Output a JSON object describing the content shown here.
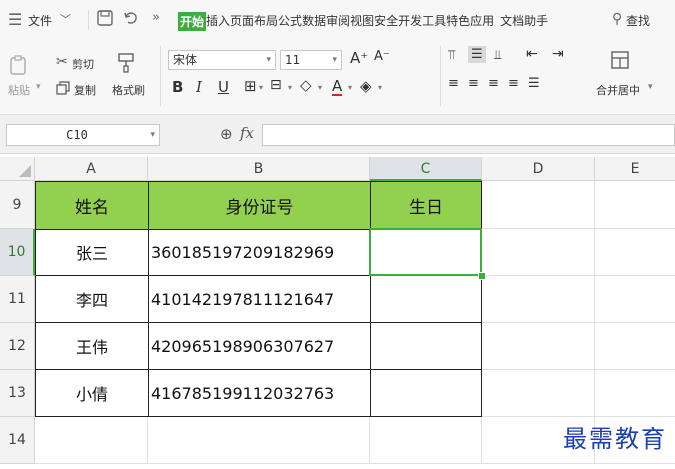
{
  "menubar": {
    "file_label": "文件",
    "tabs": [
      {
        "label": "开始"
      },
      {
        "label": "插入"
      },
      {
        "label": "页面布局"
      },
      {
        "label": "公式"
      },
      {
        "label": "数据"
      },
      {
        "label": "审阅"
      },
      {
        "label": "视图"
      },
      {
        "label": "安全"
      },
      {
        "label": "开发工具"
      },
      {
        "label": "特色应用"
      },
      {
        "label": "文档助手"
      }
    ],
    "search_label": "查找"
  },
  "ribbon": {
    "paste_label": "粘贴",
    "cut_label": "剪切",
    "copy_label": "复制",
    "format_painter_label": "格式刷",
    "font_name": "宋体",
    "font_size": "11",
    "merge_label": "合并居中"
  },
  "formula_bar": {
    "name_box": "C10",
    "fx_label": "fx",
    "formula_value": ""
  },
  "sheet": {
    "columns": [
      "A",
      "B",
      "C",
      "D",
      "E"
    ],
    "selected_column": "C",
    "rows": [
      {
        "num": "9",
        "a": "姓名",
        "b": "身份证号",
        "c": "生日"
      },
      {
        "num": "10",
        "a": "张三",
        "b": "360185197209182969",
        "c": ""
      },
      {
        "num": "11",
        "a": "李四",
        "b": "410142197811121647",
        "c": ""
      },
      {
        "num": "12",
        "a": "王伟",
        "b": "420965198906307627",
        "c": ""
      },
      {
        "num": "13",
        "a": "小倩",
        "b": "416785199112032763",
        "c": ""
      },
      {
        "num": "14",
        "a": "",
        "b": "",
        "c": ""
      }
    ],
    "selected_row": "10",
    "header_fill": "#92d050",
    "accent": "#3dae3b"
  },
  "watermark": "最需教育"
}
